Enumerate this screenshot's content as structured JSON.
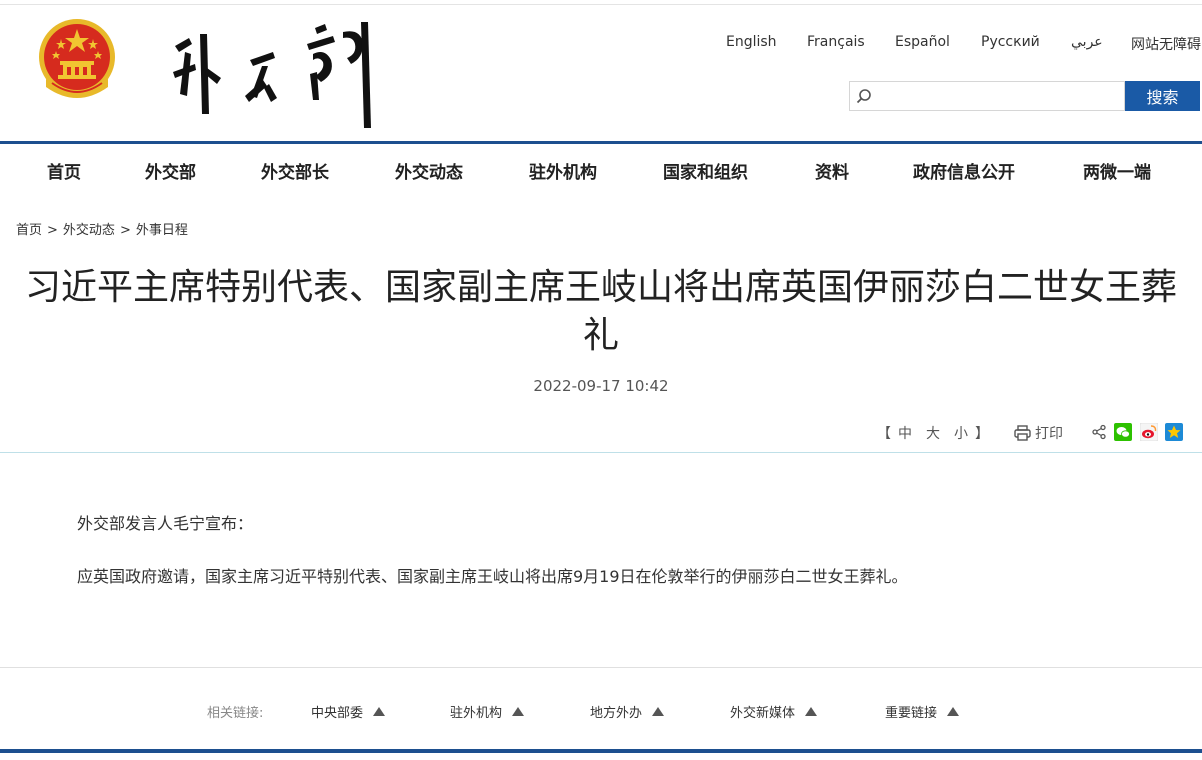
{
  "header": {
    "languages": [
      "English",
      "Français",
      "Español",
      "Русский",
      "عربي",
      "网站无障碍"
    ],
    "search": {
      "placeholder": "",
      "button_label": "搜索"
    }
  },
  "nav": {
    "items": [
      "首页",
      "外交部",
      "外交部长",
      "外交动态",
      "驻外机构",
      "国家和组织",
      "资料",
      "政府信息公开",
      "两微一端"
    ]
  },
  "breadcrumb": {
    "items": [
      "首页",
      "外交动态",
      "外事日程"
    ],
    "separator": ">"
  },
  "article": {
    "title": "习近平主席特别代表、国家副主席王岐山将出席英国伊丽莎白二世女王葬礼",
    "date": "2022-09-17 10:42",
    "paragraphs": [
      "外交部发言人毛宁宣布：",
      "应英国政府邀请，国家主席习近平特别代表、国家副主席王岐山将出席9月19日在伦敦举行的伊丽莎白二世女王葬礼。"
    ]
  },
  "tools": {
    "bracket_open": "【",
    "font_sizes": [
      "中",
      "大",
      "小"
    ],
    "bracket_close": "】",
    "print_label": "打印",
    "share_icons": [
      "share-icon",
      "wechat-icon",
      "weibo-icon",
      "qzone-icon"
    ]
  },
  "footer": {
    "label": "相关链接:",
    "links": [
      "中央部委",
      "驻外机构",
      "地方外办",
      "外交新媒体",
      "重要链接"
    ]
  },
  "colors": {
    "brand_blue": "#1d4f8f",
    "button_blue": "#1a5aa6",
    "emblem_red": "#d62b1e",
    "emblem_gold": "#f1c531"
  }
}
